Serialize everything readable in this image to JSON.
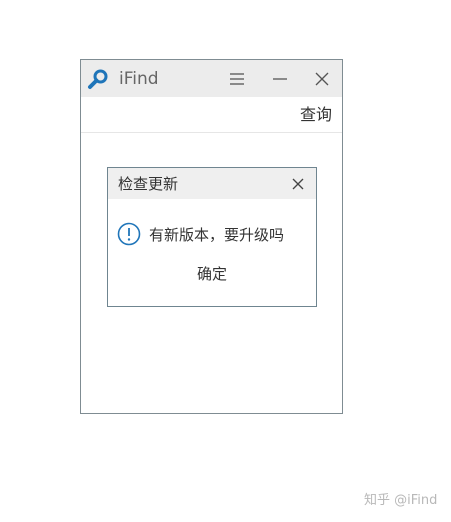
{
  "window": {
    "app_title": "iFind",
    "logo_icon": "search-icon",
    "menu_icon": "hamburger-menu-icon",
    "minimize_icon": "minimize-icon",
    "close_icon": "close-icon"
  },
  "toolbar": {
    "query_label": "查询"
  },
  "dialog": {
    "title": "检查更新",
    "close_icon": "close-icon",
    "info_icon": "info-icon",
    "message": "有新版本，要升级吗",
    "confirm_label": "确定"
  },
  "watermark": {
    "text": "知乎 @iFind"
  },
  "colors": {
    "accent": "#1f75b9",
    "titlebar_bg": "#ececec",
    "dialog_border": "#6f8590"
  }
}
